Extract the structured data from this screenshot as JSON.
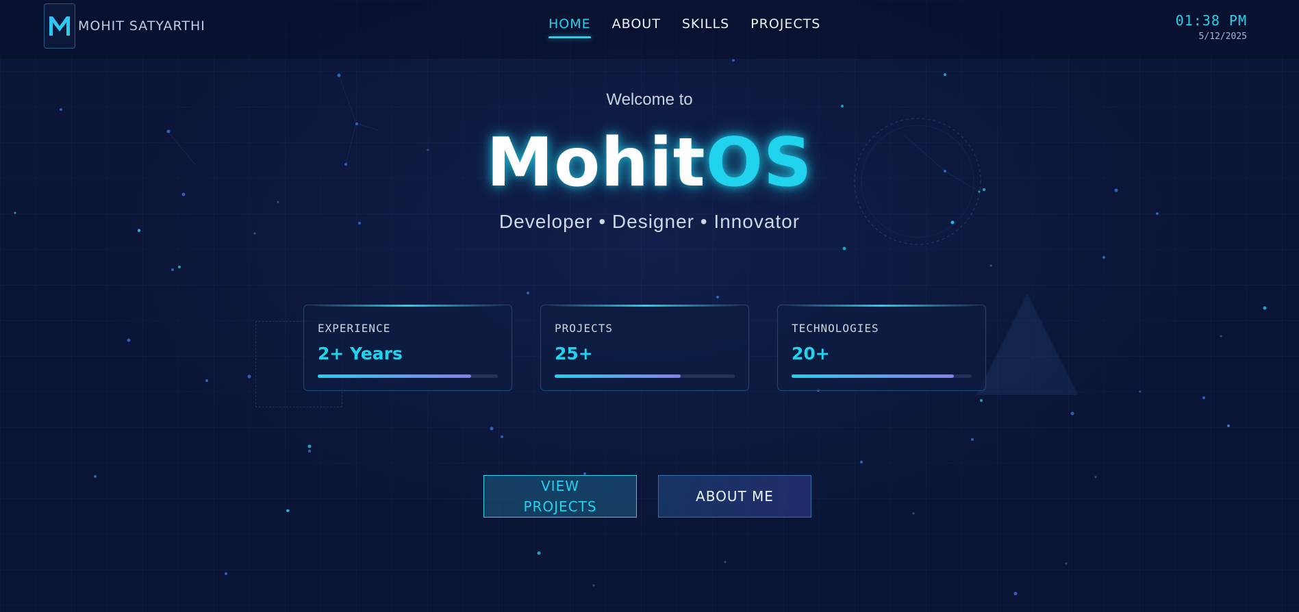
{
  "brand": {
    "logo_letter": "M",
    "name": "MOHIT SATYARTHI"
  },
  "nav": {
    "items": [
      {
        "label": "HOME",
        "active": true
      },
      {
        "label": "ABOUT",
        "active": false
      },
      {
        "label": "SKILLS",
        "active": false
      },
      {
        "label": "PROJECTS",
        "active": false
      }
    ]
  },
  "clock": {
    "time": "01:38 PM",
    "date": "5/12/2025"
  },
  "hero": {
    "welcome": "Welcome to",
    "title_part1": "Mohit",
    "title_part2": "OS",
    "tagline": "Developer • Designer • Innovator"
  },
  "stats": [
    {
      "label": "EXPERIENCE",
      "value": "2+ Years",
      "progress": 0.85
    },
    {
      "label": "PROJECTS",
      "value": "25+",
      "progress": 0.7
    },
    {
      "label": "TECHNOLOGIES",
      "value": "20+",
      "progress": 0.9
    }
  ],
  "buttons": {
    "view_projects": "VIEW PROJECTS",
    "about_me": "ABOUT ME"
  },
  "colors": {
    "accent": "#22d3ee",
    "background": "#0a1433",
    "progress_end": "#8b7cf0"
  }
}
